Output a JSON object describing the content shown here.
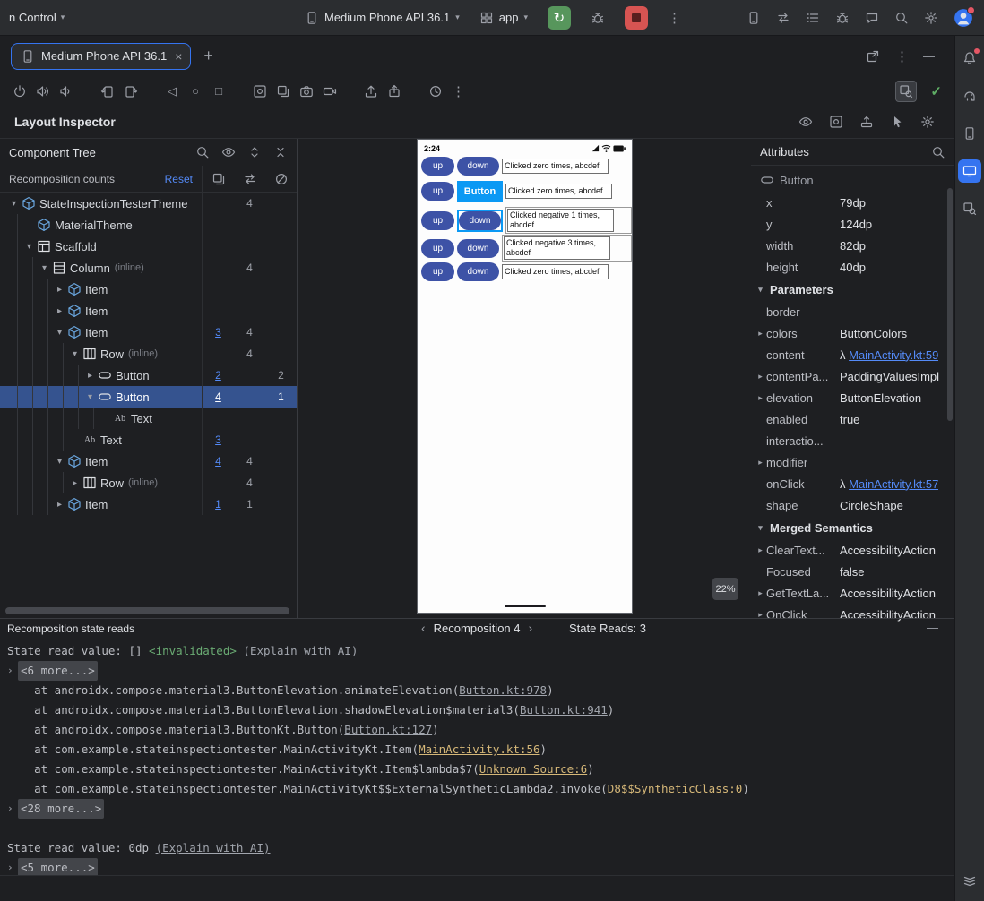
{
  "colors": {
    "accent_blue": "#3574f0",
    "link_blue": "#548af7",
    "selection_row": "#35538f",
    "run_green": "#57965c",
    "stop_red": "#d75452",
    "device_button_indigo": "#3d52a6",
    "inspector_highlight_blue": "#0b99f4",
    "console_green": "#6aab73",
    "console_yellow_link": "#d5b778"
  },
  "icons": {
    "chevron_down": "▾",
    "chevron_right": "▸",
    "close": "×",
    "add": "+",
    "more_vertical": "⋮",
    "check": "✓",
    "back": "◁",
    "home": "○",
    "overview": "□",
    "minimize": "—",
    "prev": "‹",
    "next": "›",
    "rerun": "↻",
    "fold_arrow": "›",
    "lambda": "λ"
  },
  "titlebar": {
    "vcs_label": "n Control",
    "device_selector": "Medium Phone API 36.1",
    "module_selector": "app"
  },
  "tabbar": {
    "active_tab": "Medium Phone API 36.1"
  },
  "inspector": {
    "title": "Layout Inspector"
  },
  "component_tree": {
    "title": "Component Tree",
    "counts_header": "Recomposition counts",
    "reset_label": "Reset",
    "nodes": [
      {
        "label": "StateInspectionTesterTheme",
        "depth": 0,
        "chevron": "down",
        "icon": "compose",
        "c2": "4"
      },
      {
        "label": "MaterialTheme",
        "depth": 1,
        "chevron": "none",
        "icon": "compose"
      },
      {
        "label": "Scaffold",
        "depth": 1,
        "chevron": "down",
        "icon": "scaffold"
      },
      {
        "label": "Column",
        "suffix": "(inline)",
        "depth": 2,
        "chevron": "down",
        "icon": "column",
        "c2": "4"
      },
      {
        "label": "Item",
        "depth": 3,
        "chevron": "right",
        "icon": "compose"
      },
      {
        "label": "Item",
        "depth": 3,
        "chevron": "right",
        "icon": "compose"
      },
      {
        "label": "Item",
        "depth": 3,
        "chevron": "down",
        "icon": "compose",
        "c1": "3",
        "c2": "4"
      },
      {
        "label": "Row",
        "suffix": "(inline)",
        "depth": 4,
        "chevron": "down",
        "icon": "row",
        "c2": "4"
      },
      {
        "label": "Button",
        "depth": 5,
        "chevron": "right",
        "icon": "button",
        "c1": "2",
        "c3": "2"
      },
      {
        "label": "Button",
        "depth": 5,
        "chevron": "down",
        "icon": "button",
        "c1": "4",
        "c3": "1",
        "selected": true
      },
      {
        "label": "Text",
        "depth": 6,
        "chevron": "none",
        "icon": "text"
      },
      {
        "label": "Text",
        "depth": 4,
        "chevron": "none",
        "icon": "text",
        "c1": "3"
      },
      {
        "label": "Item",
        "depth": 3,
        "chevron": "down",
        "icon": "compose",
        "c1": "4",
        "c2": "4"
      },
      {
        "label": "Row",
        "suffix": "(inline)",
        "depth": 4,
        "chevron": "right",
        "icon": "row",
        "c2": "4"
      },
      {
        "label": "Item",
        "depth": 3,
        "chevron": "right",
        "icon": "compose",
        "c1": "1",
        "c2": "1"
      }
    ]
  },
  "device": {
    "statusbar_time": "2:24",
    "zoom_badge": "22%",
    "up_label": "up",
    "down_label": "down",
    "selected_node_label": "Button",
    "rows": [
      {
        "text": "Clicked zero times, abcdef",
        "tall": false,
        "down_state": "normal"
      },
      {
        "text": "Clicked zero times, abcdef",
        "tall": false,
        "down_state": "label"
      },
      {
        "text": "Clicked negative 1 times, abcdef",
        "tall": true,
        "down_state": "selected"
      },
      {
        "text": "Clicked negative 3 times, abcdef",
        "tall": true,
        "down_state": "normal"
      },
      {
        "text": "Clicked zero times, abcdef",
        "tall": false,
        "down_state": "normal"
      }
    ]
  },
  "attributes": {
    "title": "Attributes",
    "component": "Button",
    "rows": [
      {
        "kind": "prop",
        "name": "x",
        "value": "79dp"
      },
      {
        "kind": "prop",
        "name": "y",
        "value": "124dp"
      },
      {
        "kind": "prop",
        "name": "width",
        "value": "82dp"
      },
      {
        "kind": "prop",
        "name": "height",
        "value": "40dp"
      },
      {
        "kind": "section",
        "name": "Parameters"
      },
      {
        "kind": "prop",
        "name": "border",
        "value": ""
      },
      {
        "kind": "prop",
        "name": "colors",
        "value": "ButtonColors",
        "expandable": true
      },
      {
        "kind": "prop",
        "name": "content",
        "value": "MainActivity.kt:59",
        "lambda": true
      },
      {
        "kind": "prop",
        "name": "contentPa...",
        "value": "PaddingValuesImpl",
        "expandable": true
      },
      {
        "kind": "prop",
        "name": "elevation",
        "value": "ButtonElevation",
        "expandable": true
      },
      {
        "kind": "prop",
        "name": "enabled",
        "value": "true"
      },
      {
        "kind": "prop",
        "name": "interactio...",
        "value": ""
      },
      {
        "kind": "prop",
        "name": "modifier",
        "value": "",
        "expandable": true
      },
      {
        "kind": "prop",
        "name": "onClick",
        "value": "MainActivity.kt:57",
        "lambda": true
      },
      {
        "kind": "prop",
        "name": "shape",
        "value": "CircleShape"
      },
      {
        "kind": "section",
        "name": "Merged Semantics"
      },
      {
        "kind": "prop",
        "name": "ClearText...",
        "value": "AccessibilityAction",
        "expandable": true
      },
      {
        "kind": "prop",
        "name": "Focused",
        "value": "false"
      },
      {
        "kind": "prop",
        "name": "GetTextLa...",
        "value": "AccessibilityAction",
        "expandable": true
      },
      {
        "kind": "prop",
        "name": "OnClick",
        "value": "AccessibilityAction",
        "expandable": true
      }
    ]
  },
  "console_header": {
    "title": "Recomposition state reads",
    "nav_label": "Recomposition 4",
    "state_reads": "State Reads: 3"
  },
  "console": {
    "lines": [
      {
        "fold": false,
        "segments": [
          {
            "t": "State read value: [] ",
            "s": "p"
          },
          {
            "t": "<invalidated>",
            "s": "g"
          },
          {
            "t": " ",
            "s": "p"
          },
          {
            "t": "(Explain with AI)",
            "s": "l"
          }
        ]
      },
      {
        "fold": true,
        "segments": [
          {
            "t": "<6 more...>",
            "s": "p"
          }
        ]
      },
      {
        "fold": false,
        "segments": [
          {
            "t": "    at androidx.compose.material3.ButtonElevation.animateElevation(",
            "s": "p"
          },
          {
            "t": "Button.kt:978",
            "s": "l"
          },
          {
            "t": ")",
            "s": "p"
          }
        ]
      },
      {
        "fold": false,
        "segments": [
          {
            "t": "    at androidx.compose.material3.ButtonElevation.shadowElevation$material3(",
            "s": "p"
          },
          {
            "t": "Button.kt:941",
            "s": "l"
          },
          {
            "t": ")",
            "s": "p"
          }
        ]
      },
      {
        "fold": false,
        "segments": [
          {
            "t": "    at androidx.compose.material3.ButtonKt.Button(",
            "s": "p"
          },
          {
            "t": "Button.kt:127",
            "s": "l"
          },
          {
            "t": ")",
            "s": "p"
          }
        ]
      },
      {
        "fold": false,
        "segments": [
          {
            "t": "    at com.example.stateinspectiontester.MainActivityKt.Item(",
            "s": "p"
          },
          {
            "t": "MainActivity.kt:56",
            "s": "y"
          },
          {
            "t": ")",
            "s": "p"
          }
        ]
      },
      {
        "fold": false,
        "segments": [
          {
            "t": "    at com.example.stateinspectiontester.MainActivityKt.Item$lambda$7(",
            "s": "p"
          },
          {
            "t": "Unknown Source:6",
            "s": "y"
          },
          {
            "t": ")",
            "s": "p"
          }
        ]
      },
      {
        "fold": false,
        "segments": [
          {
            "t": "    at com.example.stateinspectiontester.MainActivityKt$$ExternalSyntheticLambda2.invoke(",
            "s": "p"
          },
          {
            "t": "D8$$SyntheticClass:0",
            "s": "y"
          },
          {
            "t": ")",
            "s": "p"
          }
        ]
      },
      {
        "fold": true,
        "segments": [
          {
            "t": "<28 more...>",
            "s": "p"
          }
        ]
      },
      {
        "fold": false,
        "segments": []
      },
      {
        "fold": false,
        "segments": [
          {
            "t": "State read value: 0dp ",
            "s": "p"
          },
          {
            "t": "(Explain with AI)",
            "s": "l"
          }
        ]
      },
      {
        "fold": true,
        "segments": [
          {
            "t": "<5 more...>",
            "s": "p"
          }
        ]
      }
    ]
  }
}
